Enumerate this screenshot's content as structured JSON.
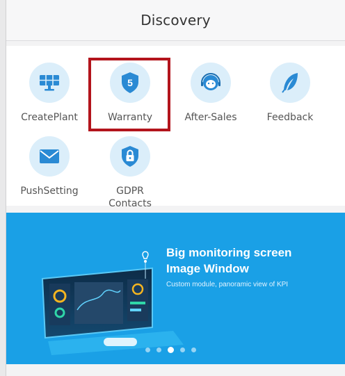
{
  "header": {
    "title": "Discovery"
  },
  "grid": {
    "items": [
      {
        "label": "CreatePlant",
        "icon": "solar-panel-icon"
      },
      {
        "label": "Warranty",
        "icon": "shield-5-icon",
        "badge": "5"
      },
      {
        "label": "After-Sales",
        "icon": "customer-service-icon"
      },
      {
        "label": "Feedback",
        "icon": "feather-icon"
      },
      {
        "label": "PushSetting",
        "icon": "envelope-icon"
      },
      {
        "label": "GDPR\nContacts",
        "icon": "lock-shield-icon"
      }
    ],
    "highlighted_item": "Warranty"
  },
  "banner": {
    "title_line1": "Big monitoring screen",
    "title_line2": "Image Window",
    "subtitle": "Custom module, panoramic view of KPI",
    "dots_total": 5,
    "active_dot": 3
  },
  "colors": {
    "accent": "#1aa0e6",
    "icon_bg": "#dbeefa",
    "highlight": "#b3141c"
  }
}
